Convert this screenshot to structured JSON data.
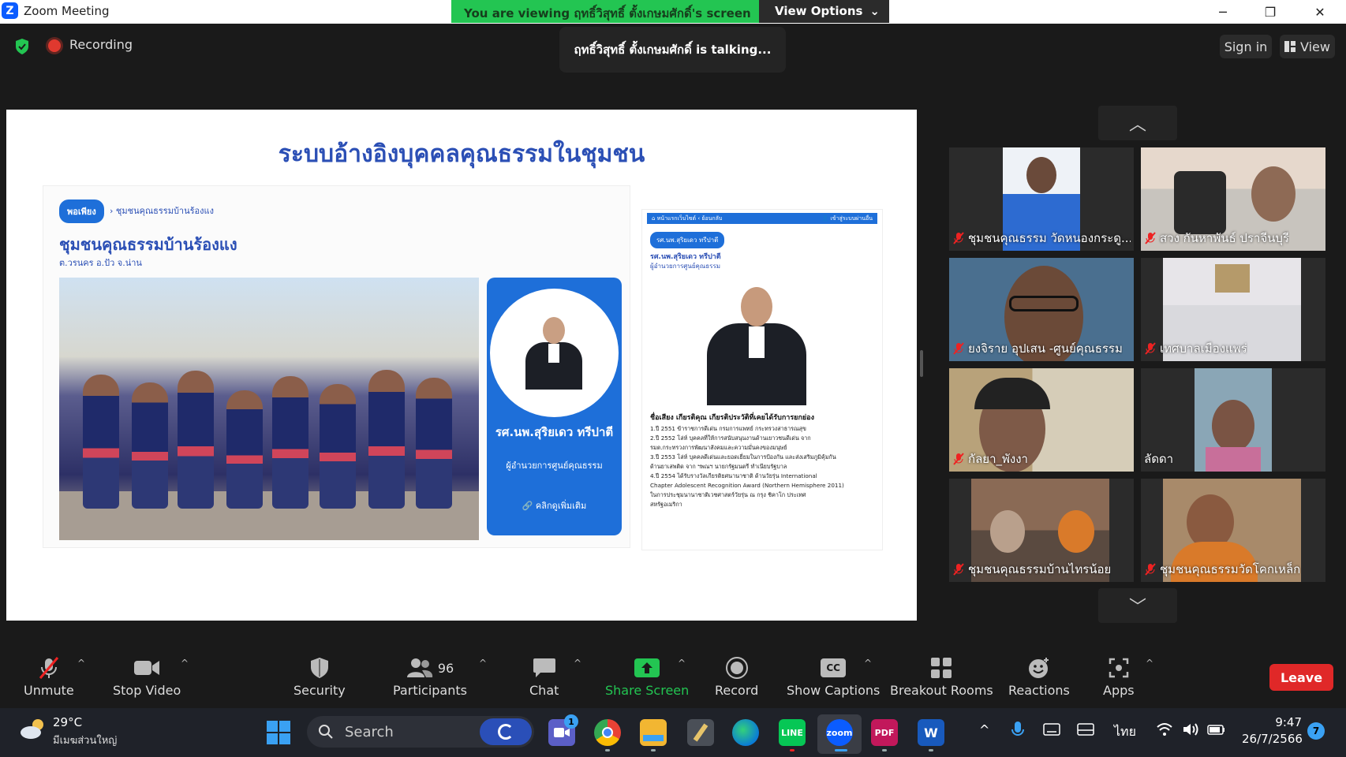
{
  "window": {
    "title": "Zoom Meeting",
    "minimize": "─",
    "restore": "❐",
    "close": "✕"
  },
  "banner": {
    "message": "You are viewing ฤทธิ์วิสุทธิ์ ตั้งเกษมศักดิ์'s screen",
    "view_options": "View Options",
    "chevron": "⌄"
  },
  "header": {
    "recording": "Recording",
    "talking": "ฤทธิ์วิสุทธิ์ ตั้งเกษมศักดิ์ is talking...",
    "sign_in": "Sign in",
    "view": "View"
  },
  "slide": {
    "title": "ระบบอ้างอิงบุคคลคุณธรรมในชุมชน",
    "pill": "พอเพียง",
    "crumb": "›  ชุมชนคุณธรรมบ้านร้องแง",
    "community_title": "ชุมชนคุณธรรมบ้านร้องแง",
    "community_sub": "ต.วรนคร อ.ปัว จ.น่าน",
    "card_name": "รศ.นพ.สุริยเดว ทรีปาตี",
    "card_role": "ผู้อำนวยการศูนย์คุณธรรม",
    "card_more": "🔗  คลิกดูเพิ่มเติม",
    "right_nav_left": "⌂ หน้าแรกเว็บไซต์  ‹ ย้อนกลับ",
    "right_nav_right": "👤 เข้าสู่ระบบผ่านอื่น",
    "right_pill": "รศ.นพ.สุริยเดว ทรีปาตี",
    "right_name": "รศ.นพ.สุริยเดว ทรีปาตี",
    "right_role": "ผู้อำนวยการศูนย์คุณธรรม",
    "right_heading": "ชื่อเสียง เกียรติคุณ เกียรติประวัติที่เคยได้รับการยกย่อง",
    "right_lines": [
      "1.ปี 2551 ข้าราชการดีเด่น กรมการแพทย์ กระทรวงสาธารณสุข",
      "2.ปี 2552 โล่ห์ บุคคลที่ให้การสนับสนุนงานด้านเยาวชนดีเด่น จาก",
      "รมต.กระทรวงการพัฒนาสังคมและความมั่นคงของมนุษย์",
      "3.ปี 2553 โล่ห์ บุคคลดีเด่นและยอดเยี่ยมในการป้องกัน และส่งเสริมภูมิคุ้มกัน",
      "ด้านยาเสพติด จาก ฯพณฯ นายกรัฐมนตรี ทำเนียบรัฐบาล",
      "4.ปี 2554 ได้รับรางวัลเกียรติยศนานาชาติ ด้านวัยรุ่น International",
      "Chapter Adolescent Recognition Award (Northern Hemisphere 2011)",
      "ในการประชุมนานาชาติเวชศาสตร์วัยรุ่น ณ กรุง ชิคาโก ประเทศ",
      "สหรัฐอเมริกา"
    ]
  },
  "gallery": {
    "up": "︿",
    "down": "﹀",
    "participants": [
      {
        "name": "ชุมชนคุณธรรม วัดหนองกระดู...",
        "muted": true,
        "bg": "#c9d7e8",
        "face": "#6a4a3a"
      },
      {
        "name": "สวง กันหาพันธ์ ปราจีนบุรี",
        "muted": true,
        "bg": "#e6d8cc",
        "face": "#8e6a55"
      },
      {
        "name": "ยงจิราย อุปเสน -ศูนย์คุณธรรม",
        "muted": true,
        "bg": "#4a6f8f",
        "face": "#6b4a38"
      },
      {
        "name": "เทศบาลเมืองแพร่",
        "muted": true,
        "bg": "#e7e5e9",
        "face": "#b59a6a"
      },
      {
        "name": "กัลยา_พังงา",
        "muted": true,
        "bg": "#b8a27a",
        "face": "#7e5a48"
      },
      {
        "name": "ลัดดา",
        "muted": false,
        "bg": "#8aa6b6",
        "face": "#7a5444"
      },
      {
        "name": "ชุมชนคุณธรรมบ้านไทรน้อย",
        "muted": true,
        "bg": "#8a6a55",
        "face": "#b9a08c"
      },
      {
        "name": "ชุมชนคุณธรรมวัดโคกเหล็ก",
        "muted": true,
        "bg": "#a88a6a",
        "face": "#d97a2a"
      }
    ]
  },
  "toolbar": {
    "unmute": "Unmute",
    "stop_video": "Stop Video",
    "security": "Security",
    "participants": "Participants",
    "participant_count": "96",
    "chat": "Chat",
    "share_screen": "Share Screen",
    "record": "Record",
    "show_captions": "Show Captions",
    "captions_icon": "CC",
    "breakout_rooms": "Breakout Rooms",
    "reactions": "Reactions",
    "apps": "Apps",
    "leave": "Leave",
    "caret": "^"
  },
  "taskbar": {
    "temperature": "29°C",
    "weather": "มีเมฆส่วนใหญ่",
    "search_placeholder": "Search",
    "teams_badge": "1",
    "zoom_label": "zoom",
    "pdf_label": "PDF",
    "word_label": "W",
    "line_label": "LINE",
    "tray_up": "^",
    "language": "ไทย",
    "time": "9:47",
    "date": "26/7/2566",
    "notifications": "7"
  },
  "colors": {
    "accent_green": "#23c552",
    "leave_red": "#e02828",
    "slide_blue": "#2b4fb5"
  }
}
